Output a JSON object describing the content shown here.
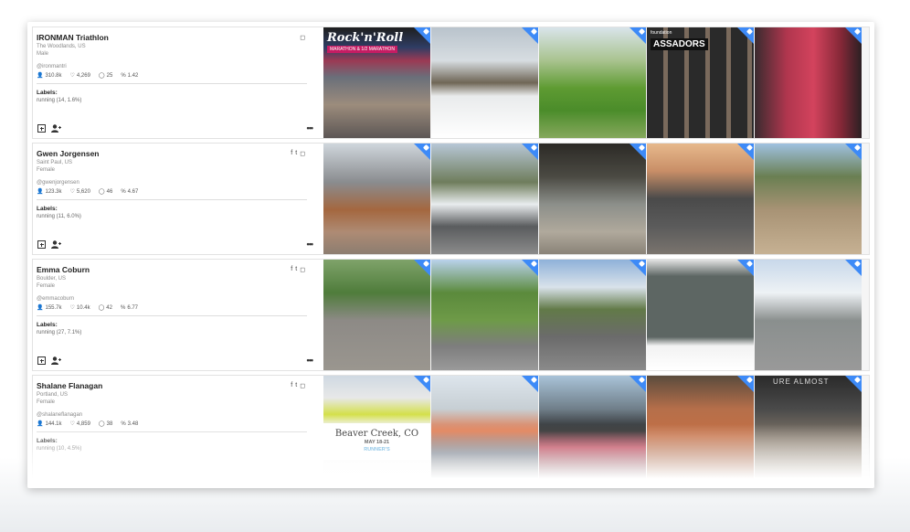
{
  "rows": [
    {
      "name": "IRONMAN Triathlon",
      "location": "The Woodlands, US",
      "gender": "Male",
      "handle": "@ironmantri",
      "followers": "310.8k",
      "likes": "4,269",
      "comments": "25",
      "engagement": "1.42",
      "labels_title": "Labels:",
      "labels_value": "running (14, 1.6%)",
      "social": [
        "instagram"
      ],
      "photo_texts": {
        "rock_title": "Rock'n'Roll",
        "rock_sub": "MARATHON & 1/2 MARATHON",
        "amb_small": "foundation",
        "amb_title": "ASSADORS"
      }
    },
    {
      "name": "Gwen Jorgensen",
      "location": "Saint Paul, US",
      "gender": "Female",
      "handle": "@gwenjorgensen",
      "followers": "123.3k",
      "likes": "5,620",
      "comments": "46",
      "engagement": "4.67",
      "labels_title": "Labels:",
      "labels_value": "running (11, 6.0%)",
      "social": [
        "facebook",
        "twitter",
        "instagram"
      ]
    },
    {
      "name": "Emma Coburn",
      "location": "Boulder, US",
      "gender": "Female",
      "handle": "@emmacoburn",
      "followers": "155.7k",
      "likes": "10.4k",
      "comments": "42",
      "engagement": "6.77",
      "labels_title": "Labels:",
      "labels_value": "running (27, 7.1%)",
      "social": [
        "facebook",
        "twitter",
        "instagram"
      ]
    },
    {
      "name": "Shalane Flanagan",
      "location": "Portland, US",
      "gender": "Female",
      "handle": "@shalaneflanagan",
      "followers": "144.1k",
      "likes": "4,859",
      "comments": "38",
      "engagement": "3.48",
      "labels_title": "Labels:",
      "labels_value": "running (10, 4.5%)",
      "social": [
        "facebook",
        "twitter",
        "instagram"
      ],
      "photo_texts": {
        "bc_title": "Beaver Creek, CO",
        "bc_date": "MAY 18-21",
        "bc_foot": "RUNNER'S",
        "almost": "URE ALMOST"
      }
    }
  ],
  "icons": {
    "followers": "person-icon",
    "likes": "heart-icon",
    "comments": "comment-icon",
    "engagement": "percent-icon",
    "add": "add-square-icon",
    "follow": "add-user-icon",
    "more": "more-dots-icon",
    "tag": "tag-icon"
  },
  "glyphs": {
    "followers": "👤",
    "likes": "♡",
    "comments": "◯",
    "engagement": "%",
    "more": "•••",
    "facebook": "f",
    "twitter": "t",
    "instagram": "◻"
  },
  "colors": {
    "tag": "#3d8af7",
    "row_bg": "#f5f5f5"
  }
}
